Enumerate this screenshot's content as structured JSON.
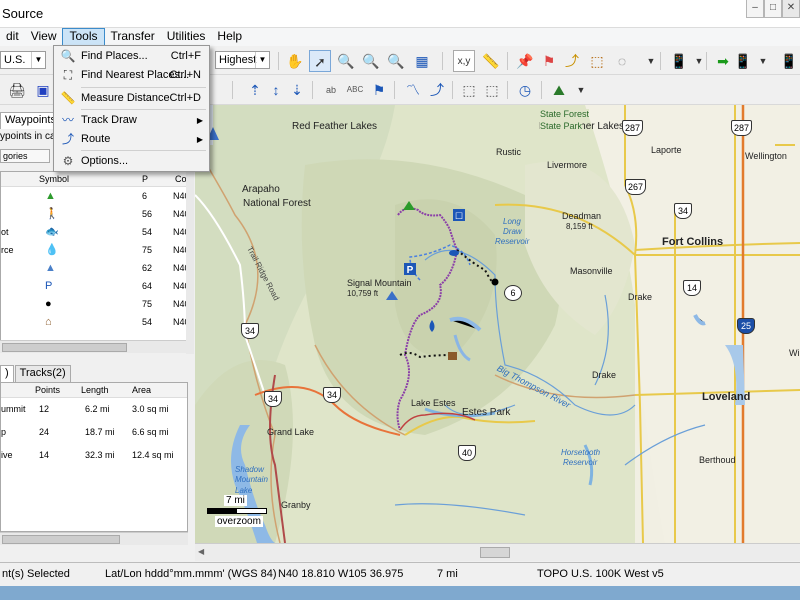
{
  "window": {
    "title": "Source",
    "controls": [
      "–",
      "□",
      "✕"
    ]
  },
  "menubar": {
    "items": [
      "dit",
      "View",
      "Tools",
      "Transfer",
      "Utilities",
      "Help"
    ],
    "active": "Tools"
  },
  "toolbar": {
    "map_product": "U.S.",
    "detail": "Highest",
    "xy_label": "x,y"
  },
  "tools_menu": {
    "items": [
      {
        "icon": "magnifier-icon",
        "label": "Find Places...",
        "shortcut": "Ctrl+F"
      },
      {
        "icon": "binoculars-icon",
        "label": "Find Nearest Places...",
        "shortcut": "Ctrl+N"
      },
      {
        "icon": "ruler-icon",
        "label": "Measure Distance",
        "shortcut": "Ctrl+D"
      },
      {
        "icon": "track-draw-icon",
        "label": "Track Draw",
        "submenu": true
      },
      {
        "icon": "route-icon",
        "label": "Route",
        "submenu": true
      },
      {
        "icon": "gear-icon",
        "label": "Options..."
      }
    ]
  },
  "left_panel": {
    "top_tab": "Waypoints(1)",
    "filter_text": "ypoints in cate",
    "category_button": "gories",
    "waypoint_columns": [
      "Symbol",
      "P",
      "Co"
    ],
    "waypoints": [
      {
        "name": "",
        "icon": "▲",
        "color": "#2e9b2e",
        "p": "6",
        "co": "N40"
      },
      {
        "name": "",
        "icon": "🚶",
        "color": "#1c57b7",
        "p": "56",
        "co": "N40"
      },
      {
        "name": "ot",
        "icon": "🐟",
        "color": "#1c57b7",
        "p": "54",
        "co": "N40"
      },
      {
        "name": "rce",
        "icon": "💧",
        "color": "#1c57b7",
        "p": "75",
        "co": "N40"
      },
      {
        "name": "",
        "icon": "▲",
        "color": "#4a80c8",
        "p": "62",
        "co": "N40"
      },
      {
        "name": "",
        "icon": "P",
        "color": "#1c57b7",
        "p": "64",
        "co": "N40"
      },
      {
        "name": "",
        "icon": "●",
        "color": "#000000",
        "p": "75",
        "co": "N40"
      },
      {
        "name": "",
        "icon": "⌂",
        "color": "#8a5a2a",
        "p": "54",
        "co": "N40"
      }
    ],
    "bottom_tabs": [
      ")",
      "Tracks(2)"
    ],
    "route_columns": [
      "Points",
      "Length",
      "Area"
    ],
    "routes": [
      {
        "name": "ummit",
        "points": "12",
        "length": "6.2 mi",
        "area": "3.0 sq mi"
      },
      {
        "name": "p",
        "points": "24",
        "length": "18.7 mi",
        "area": "6.6 sq mi"
      },
      {
        "name": "ive",
        "points": "14",
        "length": "32.3 mi",
        "area": "12.4 sq mi"
      }
    ]
  },
  "map": {
    "scale": "7 mi",
    "overzoom": "overzoom",
    "labels": [
      {
        "text": "Red Feather Lakes",
        "size": 10
      },
      {
        "text": "Red Feather Lakes",
        "size": 10
      },
      {
        "text": "Rustic",
        "size": 9
      },
      {
        "text": "Livermore",
        "size": 9
      },
      {
        "text": "Laporte",
        "size": 9
      },
      {
        "text": "Wellington",
        "size": 9
      },
      {
        "text": "Arapaho",
        "size": 10
      },
      {
        "text": "National Forest",
        "size": 10
      },
      {
        "text": "Deadman",
        "size": 9
      },
      {
        "text": "8,159 ft",
        "size": 8
      },
      {
        "text": "Fort Collins",
        "size": 11
      },
      {
        "text": "Signal Mountain",
        "size": 9
      },
      {
        "text": "10,759 ft",
        "size": 8
      },
      {
        "text": "Masonville",
        "size": 9
      },
      {
        "text": "Drake",
        "size": 9
      },
      {
        "text": "Drake",
        "size": 9
      },
      {
        "text": "Lake Estes",
        "size": 9
      },
      {
        "text": "Estes Park",
        "size": 10
      },
      {
        "text": "Loveland",
        "size": 11
      },
      {
        "text": "Grand Lake",
        "size": 9
      },
      {
        "text": "Berthoud",
        "size": 9
      },
      {
        "text": "Granby",
        "size": 9
      },
      {
        "text": "Wi",
        "size": 9
      }
    ],
    "water_labels": [
      "Long",
      "Draw",
      "Reservoir",
      "Big Thompson River",
      "Horsetooth",
      "Reservoir",
      "Shadow",
      "Mountain",
      "Lake"
    ],
    "road_label": "Trail Ridge Road",
    "park_label": [
      "Red Feather Lakes"
    ],
    "state_forest": [
      "State Forest",
      "State Park"
    ],
    "shields": [
      "287",
      "287",
      "267",
      "34",
      "14",
      "25",
      "34",
      "34",
      "34",
      "40",
      "6"
    ]
  },
  "statusbar": {
    "selected": "nt(s) Selected",
    "format": "Lat/Lon hddd°mm.mmm' (WGS 84)",
    "coords": "N40 18.810  W105 36.975",
    "distance": "7 mi",
    "map_product": "TOPO U.S. 100K West v5"
  }
}
